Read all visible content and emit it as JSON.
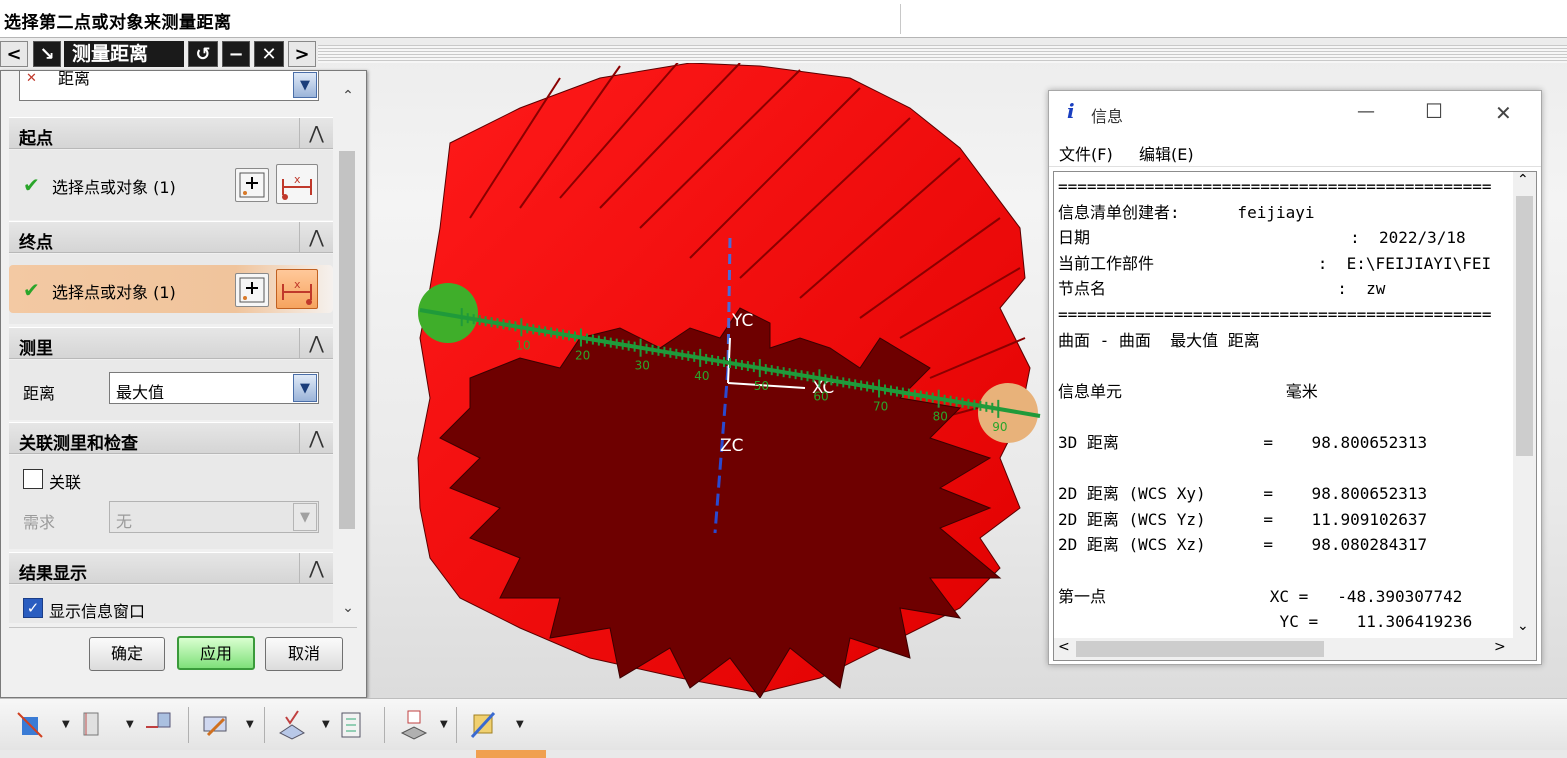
{
  "cue_line": {
    "prompt": "选择第二点或对象来测量距离"
  },
  "dialog": {
    "title": "测量距离",
    "title_buttons": {
      "back": "<",
      "reset": "↺",
      "minimize": "−",
      "close": "✕",
      "forward": ">"
    },
    "type_value": "距离",
    "start_point": {
      "header": "起点",
      "select_label": "选择点或对象 (1)"
    },
    "end_point": {
      "header": "终点",
      "select_label": "选择点或对象 (1)"
    },
    "measure": {
      "header": "测里",
      "distance_label": "距离",
      "distance_value": "最大值"
    },
    "associative": {
      "header": "关联测里和检查",
      "checkbox_label": "关联",
      "requirement_label": "需求",
      "requirement_value": "无"
    },
    "results": {
      "header": "结果显示",
      "checkbox_label": "显示信息窗口"
    },
    "buttons": {
      "ok": "确定",
      "apply": "应用",
      "cancel": "取消"
    }
  },
  "viewport": {
    "axis_labels": {
      "yc": "YC",
      "xc": "XC",
      "zc": "ZC"
    },
    "ruler_ticks": [
      "10",
      "20",
      "30",
      "40",
      "50",
      "60",
      "70",
      "80",
      "90"
    ]
  },
  "info_window": {
    "title": "信息",
    "menu": [
      "文件(F)",
      "编辑(E)"
    ],
    "lines": [
      "=============================================",
      "信息清单创建者:      feijiayi",
      "日期                           :  2022/3/18",
      "当前工作部件                 :  E:\\FEIJIAYI\\FEI",
      "节点名                        :  zw",
      "=============================================",
      "曲面 - 曲面  最大值 距离",
      "",
      "信息单元                 毫米",
      "",
      "3D 距离               =    98.800652313",
      "",
      "2D 距离 (WCS Xy)      =    98.800652313",
      "2D 距离 (WCS Yz)      =    11.909102637",
      "2D 距离 (WCS Xz)      =    98.080284317",
      "",
      "第一点                 XC =   -48.390307742",
      "                       YC =    11.306419236"
    ]
  },
  "colors": {
    "gear_red": "#ff0000",
    "gear_face": "#6e0000",
    "ruler": "#1f9a3a",
    "accent_orange": "#f5a860",
    "apply_green": "#7fe07a"
  }
}
